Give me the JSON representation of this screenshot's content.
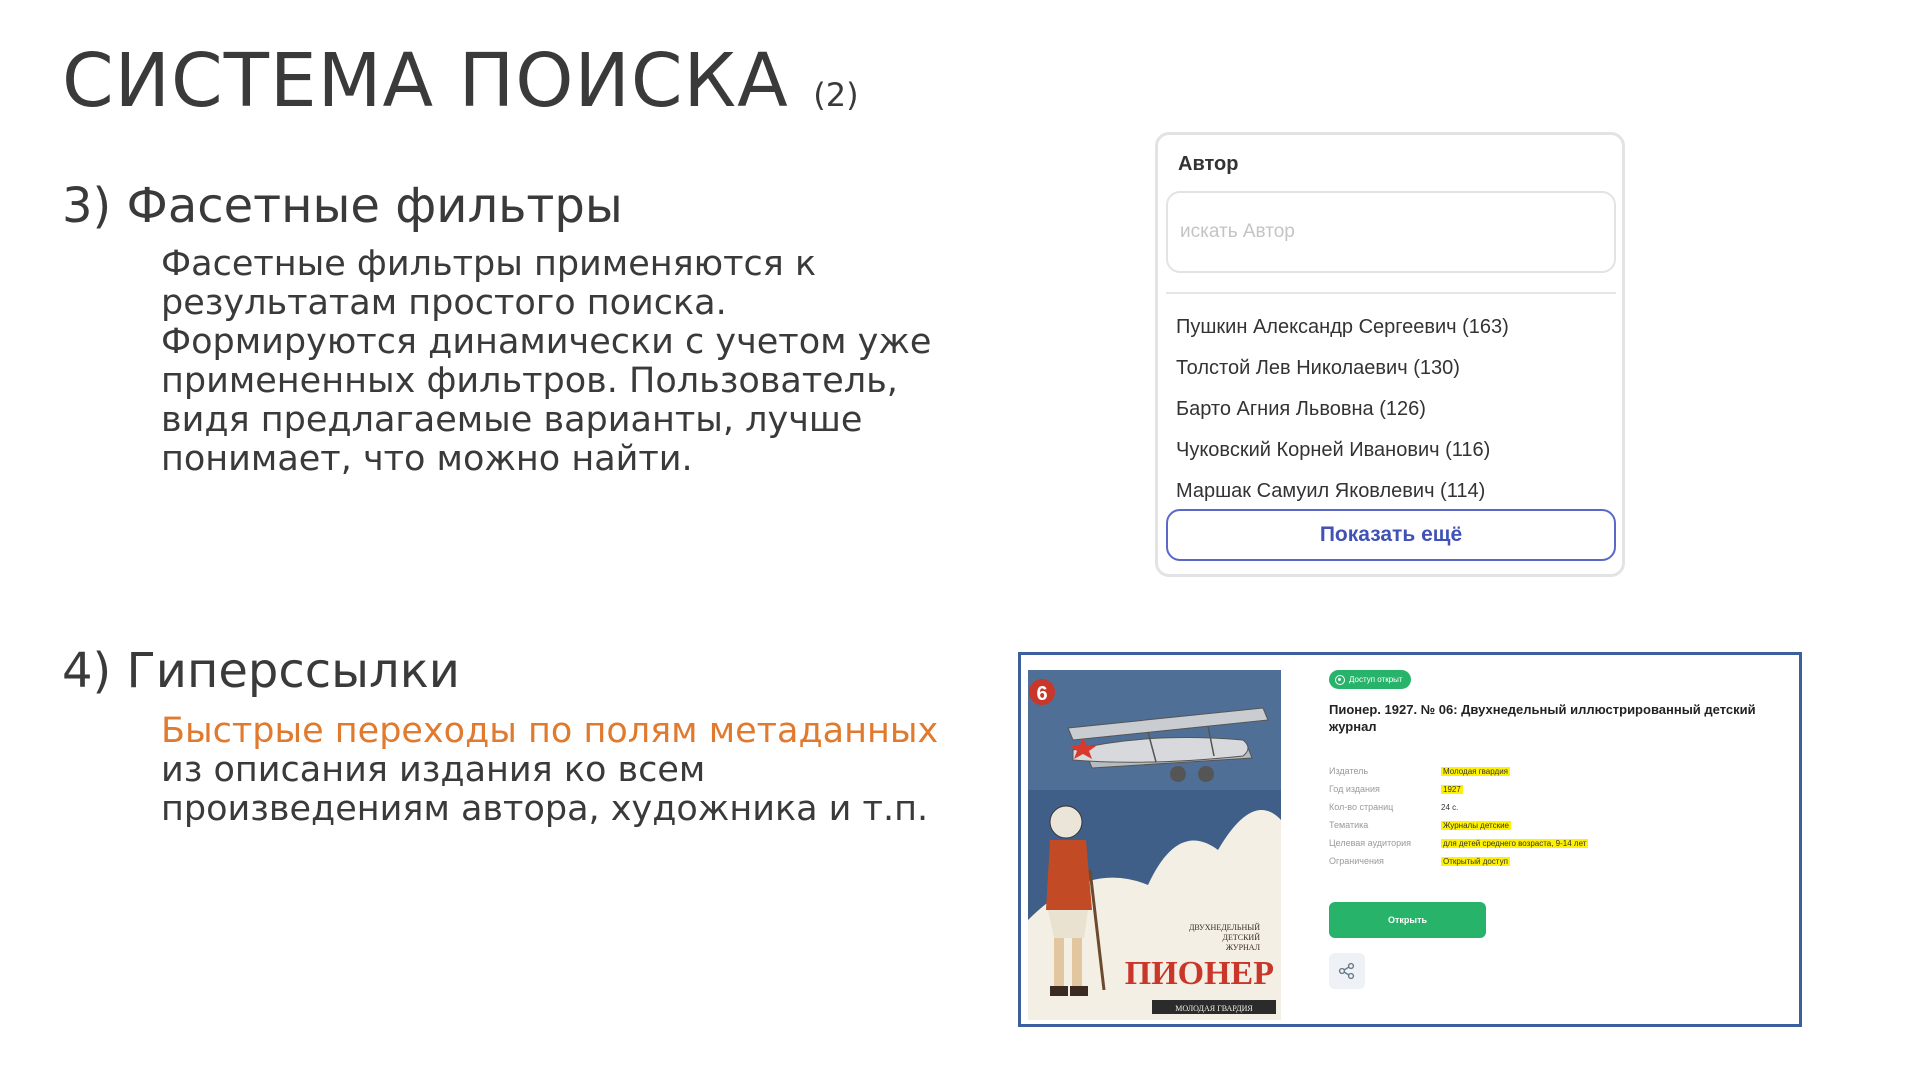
{
  "title": {
    "main": "СИСТЕМА ПОИСКА",
    "suffix": "(2)"
  },
  "section3": {
    "heading": "3) Фасетные фильтры",
    "lines": [
      "Фасетные фильтры  применяются к",
      "результатам простого поиска.",
      "Формируются динамически с учетом уже",
      "примененных фильтров. Пользователь,",
      "видя предлагаемые варианты, лучше",
      "понимает, что можно найти."
    ]
  },
  "section4": {
    "heading": "4) Гиперссылки",
    "accent_line": "Быстрые переходы по полям метаданных",
    "lines": [
      "из описания издания ко всем",
      "произведениям автора, художника и т.п."
    ]
  },
  "facet": {
    "title": "Автор",
    "search_placeholder": "искать Автор",
    "items": [
      "Пушкин Александр Сергеевич (163)",
      "Толстой Лев Николаевич (130)",
      "Барто Агния Львовна (126)",
      "Чуковский Корней Иванович (116)",
      "Маршак Самуил Яковлевич (114)"
    ],
    "more_label": "Показать ещё",
    "accent_color": "#4052b5"
  },
  "card": {
    "badge": "Доступ открыт",
    "title": "Пионер. 1927. № 06: Двухнедельный иллюстрированный детский журнал",
    "meta": [
      {
        "label": "Издатель",
        "value": "Молодая гвардия"
      },
      {
        "label": "Год издания",
        "value": "1927"
      },
      {
        "label": "Кол-во страниц",
        "value": "24 с."
      },
      {
        "label": "Тематика",
        "value": "Журналы детские"
      },
      {
        "label": "Целевая аудитория",
        "value": "для детей среднего возраста, 9-14 лет"
      },
      {
        "label": "Ограничения",
        "value": "Открытый доступ"
      }
    ],
    "open_label": "Открыть",
    "share_icon": "share-icon",
    "highlight_color": "#fff200",
    "button_color": "#27b36a",
    "cover": {
      "issue_number": "6",
      "subtitle_lines": [
        "ДВУХНЕДЕЛЬНЫЙ",
        "ДЕТСКИЙ",
        "ЖУРНАЛ"
      ],
      "magazine_title": "ПИОНЕР",
      "publisher": "МОЛОДАЯ ГВАРДИЯ"
    }
  }
}
